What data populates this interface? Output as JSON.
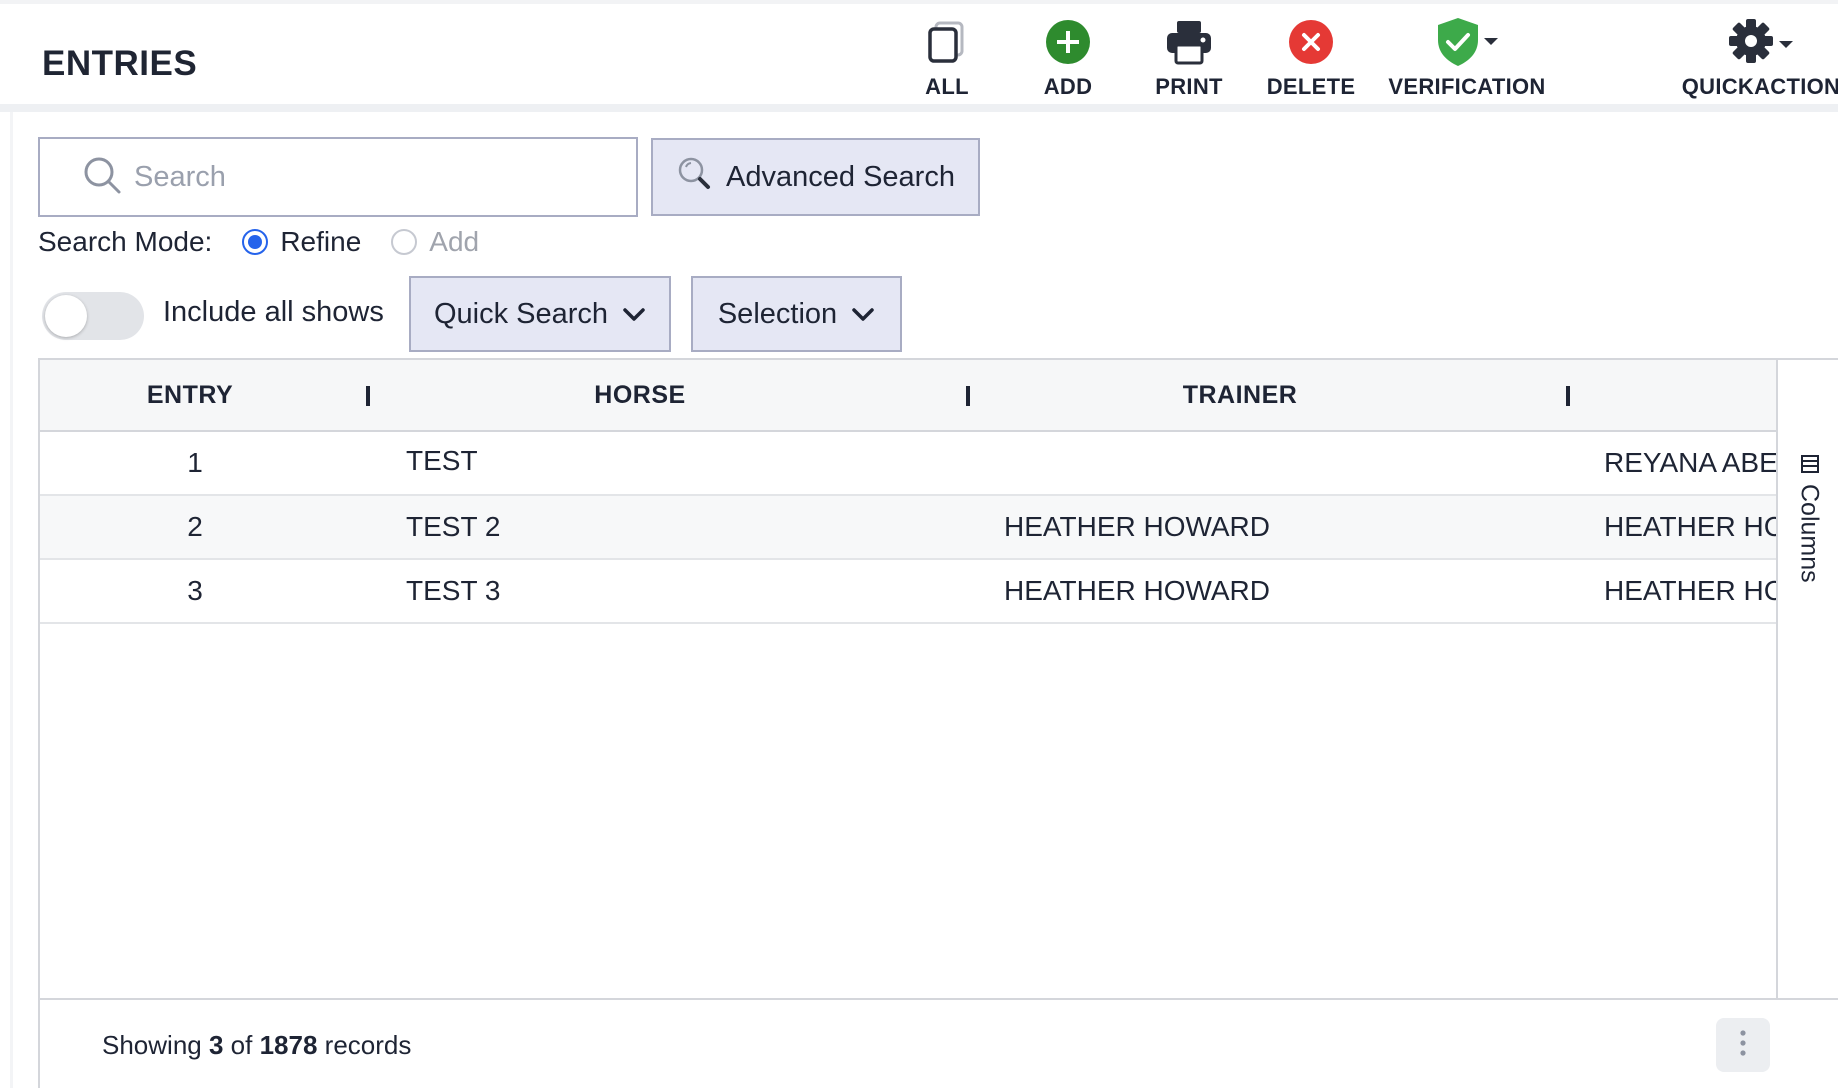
{
  "header": {
    "title": "ENTRIES",
    "tools": {
      "all": "ALL",
      "add": "ADD",
      "print": "PRINT",
      "delete": "DELETE",
      "verification": "VERIFICATION",
      "quickaction": "QUICKACTION"
    }
  },
  "search": {
    "placeholder": "Search",
    "value": "",
    "advanced_label": "Advanced Search"
  },
  "search_mode": {
    "label": "Search Mode:",
    "options": [
      "Refine",
      "Add"
    ],
    "selected": "Refine"
  },
  "filters": {
    "include_all_shows_label": "Include all shows",
    "include_all_shows": false,
    "quick_search_label": "Quick Search",
    "selection_label": "Selection"
  },
  "grid": {
    "columns": [
      "ENTRY",
      "HORSE",
      "TRAINER"
    ],
    "rows": [
      {
        "entry": "1",
        "horse": "TEST",
        "trainer": "",
        "owner": "REYANA ABE"
      },
      {
        "entry": "2",
        "horse": "TEST 2",
        "trainer": "HEATHER HOWARD",
        "owner": "HEATHER HC"
      },
      {
        "entry": "3",
        "horse": "TEST 3",
        "trainer": "HEATHER HOWARD",
        "owner": "HEATHER HC"
      }
    ],
    "side_panel_label": "Columns"
  },
  "footer": {
    "prefix": "Showing",
    "shown": "3",
    "of": "of",
    "total": "1878",
    "suffix": "records"
  },
  "colors": {
    "accent_blue": "#2563eb",
    "add_green": "#2e8b2e",
    "delete_red": "#e53935",
    "shield_green": "#3daa4a",
    "button_bg": "#e5e7f4"
  }
}
